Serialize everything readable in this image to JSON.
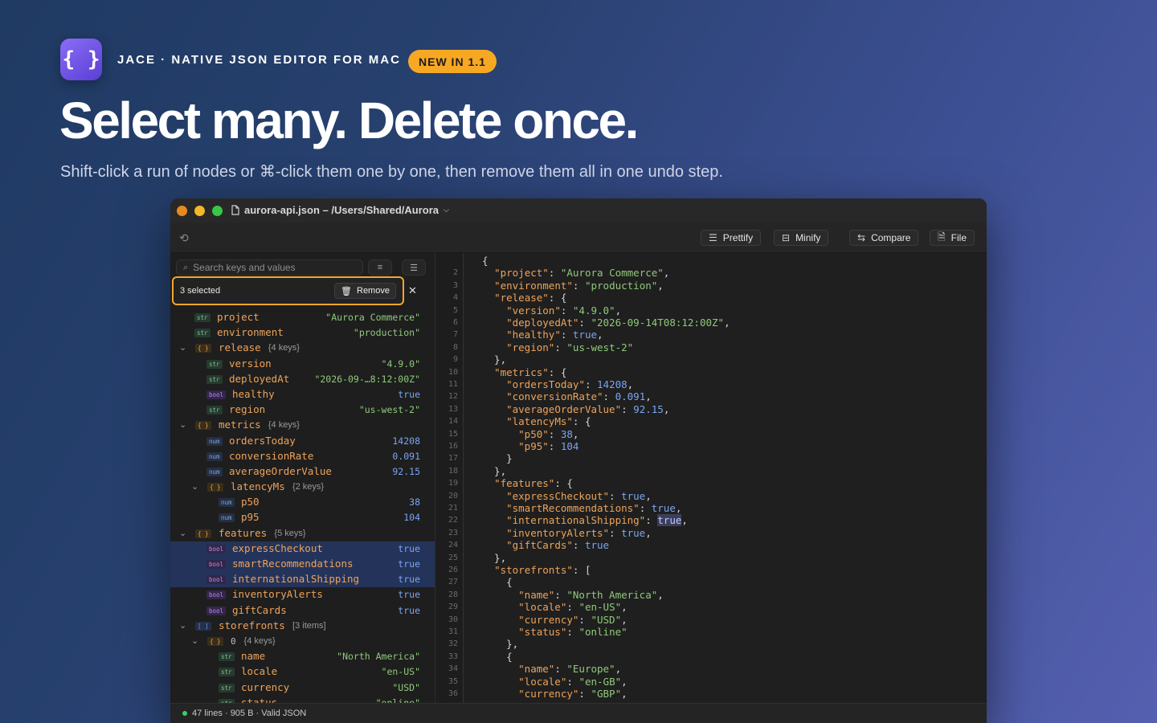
{
  "app": {
    "icon_glyph": "{ }",
    "brand": "JACE · NATIVE JSON EDITOR FOR MAC",
    "badge": "NEW IN 1.1",
    "headline": "Select many. Delete once.",
    "subline": "Shift-click a run of nodes or ⌘-click them one by one, then remove them all in one undo step."
  },
  "window": {
    "title": "aurora-api.json – /Users/Shared/Aurora",
    "traffic_colors": [
      "#e58a1f",
      "#f2b82a",
      "#38c748"
    ],
    "toolbar": {
      "prettify": "Prettify",
      "minify": "Minify",
      "compare": "Compare",
      "file": "File"
    },
    "sidebar": {
      "search_placeholder": "Search keys and values",
      "selection_count": "3 selected",
      "remove_label": "Remove"
    },
    "tree": [
      {
        "type": "str",
        "key": "project",
        "value": "\"Aurora Commerce\"",
        "depth": 1
      },
      {
        "type": "str",
        "key": "environment",
        "value": "\"production\"",
        "depth": 1
      },
      {
        "type": "obj",
        "key": "release",
        "meta": "{4 keys}",
        "depth": 0,
        "chevron": true
      },
      {
        "type": "str",
        "key": "version",
        "value": "\"4.9.0\"",
        "depth": 2
      },
      {
        "type": "str",
        "key": "deployedAt",
        "value": "\"2026-09-…8:12:00Z\"",
        "depth": 2
      },
      {
        "type": "bool",
        "key": "healthy",
        "value": "true",
        "depth": 2
      },
      {
        "type": "str",
        "key": "region",
        "value": "\"us-west-2\"",
        "depth": 2
      },
      {
        "type": "obj",
        "key": "metrics",
        "meta": "{4 keys}",
        "depth": 0,
        "chevron": true
      },
      {
        "type": "num",
        "key": "ordersToday",
        "value": "14208",
        "depth": 2
      },
      {
        "type": "num",
        "key": "conversionRate",
        "value": "0.091",
        "depth": 2
      },
      {
        "type": "num",
        "key": "averageOrderValue",
        "value": "92.15",
        "depth": 2
      },
      {
        "type": "obj",
        "key": "latencyMs",
        "meta": "{2 keys}",
        "depth": 1,
        "chevron": true
      },
      {
        "type": "num",
        "key": "p50",
        "value": "38",
        "depth": 3
      },
      {
        "type": "num",
        "key": "p95",
        "value": "104",
        "depth": 3
      },
      {
        "type": "obj",
        "key": "features",
        "meta": "{5 keys}",
        "depth": 0,
        "chevron": true
      },
      {
        "type": "bool",
        "key": "expressCheckout",
        "value": "true",
        "depth": 2,
        "selected": true
      },
      {
        "type": "bool",
        "key": "smartRecommendations",
        "value": "true",
        "depth": 2,
        "selected": true
      },
      {
        "type": "bool",
        "key": "internationalShipping",
        "value": "true",
        "depth": 2,
        "selected": true
      },
      {
        "type": "bool",
        "key": "inventoryAlerts",
        "value": "true",
        "depth": 2
      },
      {
        "type": "bool",
        "key": "giftCards",
        "value": "true",
        "depth": 2
      },
      {
        "type": "arr",
        "key": "storefronts",
        "meta": "[3 items]",
        "depth": 0,
        "chevron": true
      },
      {
        "type": "obj",
        "key": "0",
        "meta": "{4 keys}",
        "depth": 1,
        "chevron": true,
        "index": true
      },
      {
        "type": "str",
        "key": "name",
        "value": "\"North America\"",
        "depth": 3
      },
      {
        "type": "str",
        "key": "locale",
        "value": "\"en-US\"",
        "depth": 3
      },
      {
        "type": "str",
        "key": "currency",
        "value": "\"USD\"",
        "depth": 3
      },
      {
        "type": "str",
        "key": "status",
        "value": "\"online\"",
        "depth": 3
      }
    ],
    "type_tags": {
      "str": "str",
      "num": "num",
      "bool": "bool",
      "obj": "{ }",
      "arr": "[ ]"
    },
    "code": [
      {
        "n": "1",
        "t": [
          [
            "p",
            "{"
          ]
        ]
      },
      {
        "n": "2",
        "t": [
          [
            "p",
            "  "
          ],
          [
            "k",
            "\"project\""
          ],
          [
            "p",
            ": "
          ],
          [
            "s",
            "\"Aurora Commerce\""
          ],
          [
            "p",
            ","
          ]
        ]
      },
      {
        "n": "3",
        "t": [
          [
            "p",
            "  "
          ],
          [
            "k",
            "\"environment\""
          ],
          [
            "p",
            ": "
          ],
          [
            "s",
            "\"production\""
          ],
          [
            "p",
            ","
          ]
        ]
      },
      {
        "n": "4",
        "t": [
          [
            "p",
            "  "
          ],
          [
            "k",
            "\"release\""
          ],
          [
            "p",
            ": {"
          ]
        ]
      },
      {
        "n": "5",
        "t": [
          [
            "p",
            "    "
          ],
          [
            "k",
            "\"version\""
          ],
          [
            "p",
            ": "
          ],
          [
            "s",
            "\"4.9.0\""
          ],
          [
            "p",
            ","
          ]
        ]
      },
      {
        "n": "6",
        "t": [
          [
            "p",
            "    "
          ],
          [
            "k",
            "\"deployedAt\""
          ],
          [
            "p",
            ": "
          ],
          [
            "s",
            "\"2026-09-14T08:12:00Z\""
          ],
          [
            "p",
            ","
          ]
        ]
      },
      {
        "n": "7",
        "t": [
          [
            "p",
            "    "
          ],
          [
            "k",
            "\"healthy\""
          ],
          [
            "p",
            ": "
          ],
          [
            "b",
            "true"
          ],
          [
            "p",
            ","
          ]
        ]
      },
      {
        "n": "8",
        "t": [
          [
            "p",
            "    "
          ],
          [
            "k",
            "\"region\""
          ],
          [
            "p",
            ": "
          ],
          [
            "s",
            "\"us-west-2\""
          ]
        ]
      },
      {
        "n": "9",
        "t": [
          [
            "p",
            "  },"
          ]
        ]
      },
      {
        "n": "10",
        "t": [
          [
            "p",
            "  "
          ],
          [
            "k",
            "\"metrics\""
          ],
          [
            "p",
            ": {"
          ]
        ]
      },
      {
        "n": "11",
        "t": [
          [
            "p",
            "    "
          ],
          [
            "k",
            "\"ordersToday\""
          ],
          [
            "p",
            ": "
          ],
          [
            "n",
            "14208"
          ],
          [
            "p",
            ","
          ]
        ]
      },
      {
        "n": "12",
        "t": [
          [
            "p",
            "    "
          ],
          [
            "k",
            "\"conversionRate\""
          ],
          [
            "p",
            ": "
          ],
          [
            "n",
            "0.091"
          ],
          [
            "p",
            ","
          ]
        ]
      },
      {
        "n": "13",
        "t": [
          [
            "p",
            "    "
          ],
          [
            "k",
            "\"averageOrderValue\""
          ],
          [
            "p",
            ": "
          ],
          [
            "n",
            "92.15"
          ],
          [
            "p",
            ","
          ]
        ]
      },
      {
        "n": "14",
        "t": [
          [
            "p",
            "    "
          ],
          [
            "k",
            "\"latencyMs\""
          ],
          [
            "p",
            ": {"
          ]
        ]
      },
      {
        "n": "15",
        "t": [
          [
            "p",
            "      "
          ],
          [
            "k",
            "\"p50\""
          ],
          [
            "p",
            ": "
          ],
          [
            "n",
            "38"
          ],
          [
            "p",
            ","
          ]
        ]
      },
      {
        "n": "16",
        "t": [
          [
            "p",
            "      "
          ],
          [
            "k",
            "\"p95\""
          ],
          [
            "p",
            ": "
          ],
          [
            "n",
            "104"
          ]
        ]
      },
      {
        "n": "17",
        "t": [
          [
            "p",
            "    }"
          ]
        ]
      },
      {
        "n": "18",
        "t": [
          [
            "p",
            "  },"
          ]
        ]
      },
      {
        "n": "19",
        "t": [
          [
            "p",
            "  "
          ],
          [
            "k",
            "\"features\""
          ],
          [
            "p",
            ": {"
          ]
        ]
      },
      {
        "n": "20",
        "t": [
          [
            "p",
            "    "
          ],
          [
            "k",
            "\"expressCheckout\""
          ],
          [
            "p",
            ": "
          ],
          [
            "b",
            "true"
          ],
          [
            "p",
            ","
          ]
        ]
      },
      {
        "n": "21",
        "t": [
          [
            "p",
            "    "
          ],
          [
            "k",
            "\"smartRecommendations\""
          ],
          [
            "p",
            ": "
          ],
          [
            "b",
            "true"
          ],
          [
            "p",
            ","
          ]
        ]
      },
      {
        "n": "22",
        "t": [
          [
            "p",
            "    "
          ],
          [
            "k",
            "\"internationalShipping\""
          ],
          [
            "p",
            ": "
          ],
          [
            "h",
            "true"
          ],
          [
            "p",
            ","
          ]
        ]
      },
      {
        "n": "23",
        "t": [
          [
            "p",
            "    "
          ],
          [
            "k",
            "\"inventoryAlerts\""
          ],
          [
            "p",
            ": "
          ],
          [
            "b",
            "true"
          ],
          [
            "p",
            ","
          ]
        ]
      },
      {
        "n": "24",
        "t": [
          [
            "p",
            "    "
          ],
          [
            "k",
            "\"giftCards\""
          ],
          [
            "p",
            ": "
          ],
          [
            "b",
            "true"
          ]
        ]
      },
      {
        "n": "25",
        "t": [
          [
            "p",
            "  },"
          ]
        ]
      },
      {
        "n": "26",
        "t": [
          [
            "p",
            "  "
          ],
          [
            "k",
            "\"storefronts\""
          ],
          [
            "p",
            ": ["
          ]
        ]
      },
      {
        "n": "27",
        "t": [
          [
            "p",
            "    {"
          ]
        ]
      },
      {
        "n": "28",
        "t": [
          [
            "p",
            "      "
          ],
          [
            "k",
            "\"name\""
          ],
          [
            "p",
            ": "
          ],
          [
            "s",
            "\"North America\""
          ],
          [
            "p",
            ","
          ]
        ]
      },
      {
        "n": "29",
        "t": [
          [
            "p",
            "      "
          ],
          [
            "k",
            "\"locale\""
          ],
          [
            "p",
            ": "
          ],
          [
            "s",
            "\"en-US\""
          ],
          [
            "p",
            ","
          ]
        ]
      },
      {
        "n": "30",
        "t": [
          [
            "p",
            "      "
          ],
          [
            "k",
            "\"currency\""
          ],
          [
            "p",
            ": "
          ],
          [
            "s",
            "\"USD\""
          ],
          [
            "p",
            ","
          ]
        ]
      },
      {
        "n": "31",
        "t": [
          [
            "p",
            "      "
          ],
          [
            "k",
            "\"status\""
          ],
          [
            "p",
            ": "
          ],
          [
            "s",
            "\"online\""
          ]
        ]
      },
      {
        "n": "32",
        "t": [
          [
            "p",
            "    },"
          ]
        ]
      },
      {
        "n": "33",
        "t": [
          [
            "p",
            "    {"
          ]
        ]
      },
      {
        "n": "34",
        "t": [
          [
            "p",
            "      "
          ],
          [
            "k",
            "\"name\""
          ],
          [
            "p",
            ": "
          ],
          [
            "s",
            "\"Europe\""
          ],
          [
            "p",
            ","
          ]
        ]
      },
      {
        "n": "35",
        "t": [
          [
            "p",
            "      "
          ],
          [
            "k",
            "\"locale\""
          ],
          [
            "p",
            ": "
          ],
          [
            "s",
            "\"en-GB\""
          ],
          [
            "p",
            ","
          ]
        ]
      },
      {
        "n": "36",
        "t": [
          [
            "p",
            "      "
          ],
          [
            "k",
            "\"currency\""
          ],
          [
            "p",
            ": "
          ],
          [
            "s",
            "\"GBP\""
          ],
          [
            "p",
            ","
          ]
        ]
      }
    ],
    "status": "47 lines · 905 B · Valid JSON"
  }
}
